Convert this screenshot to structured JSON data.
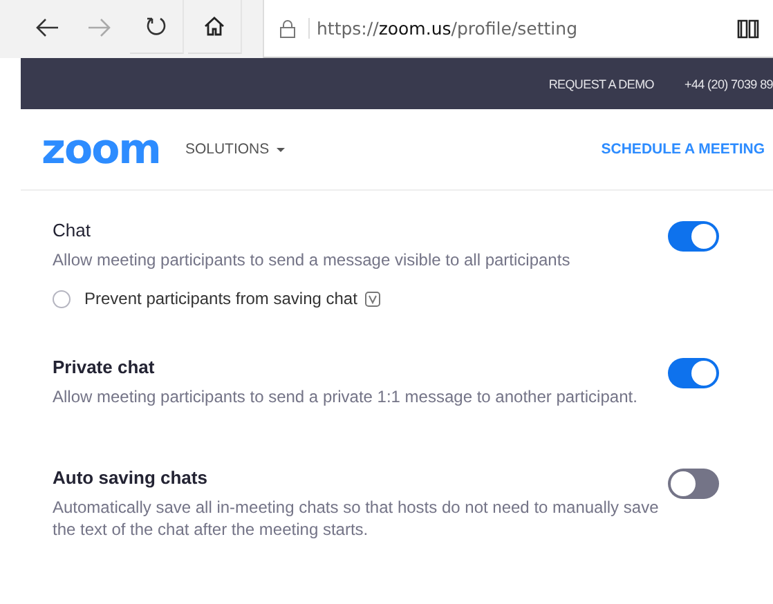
{
  "browser": {
    "url_prefix": "https://",
    "url_host": "zoom.us",
    "url_path": "/profile/setting",
    "forward_disabled": true
  },
  "top_bar": {
    "links": [
      "REQUEST A DEMO",
      "+44 (20) 7039 89"
    ]
  },
  "header": {
    "logo": "zoom",
    "nav": [
      {
        "label": "SOLUTIONS",
        "dropdown": true
      }
    ],
    "cta": "SCHEDULE A MEETING"
  },
  "settings": [
    {
      "title": "Chat",
      "description": "Allow meeting participants to send a message visible to all participants",
      "on": true,
      "options": [
        {
          "label": "Prevent participants from saving chat",
          "checked": false,
          "has_version_icon": true
        }
      ]
    },
    {
      "title": "Private chat",
      "description": "Allow meeting participants to send a private 1:1 message to another participant.",
      "on": true
    },
    {
      "title": "Auto saving chats",
      "description": "Automatically save all in-meeting chats so that hosts do not need to manually save the text of the chat after the meeting starts.",
      "on": false
    }
  ]
}
